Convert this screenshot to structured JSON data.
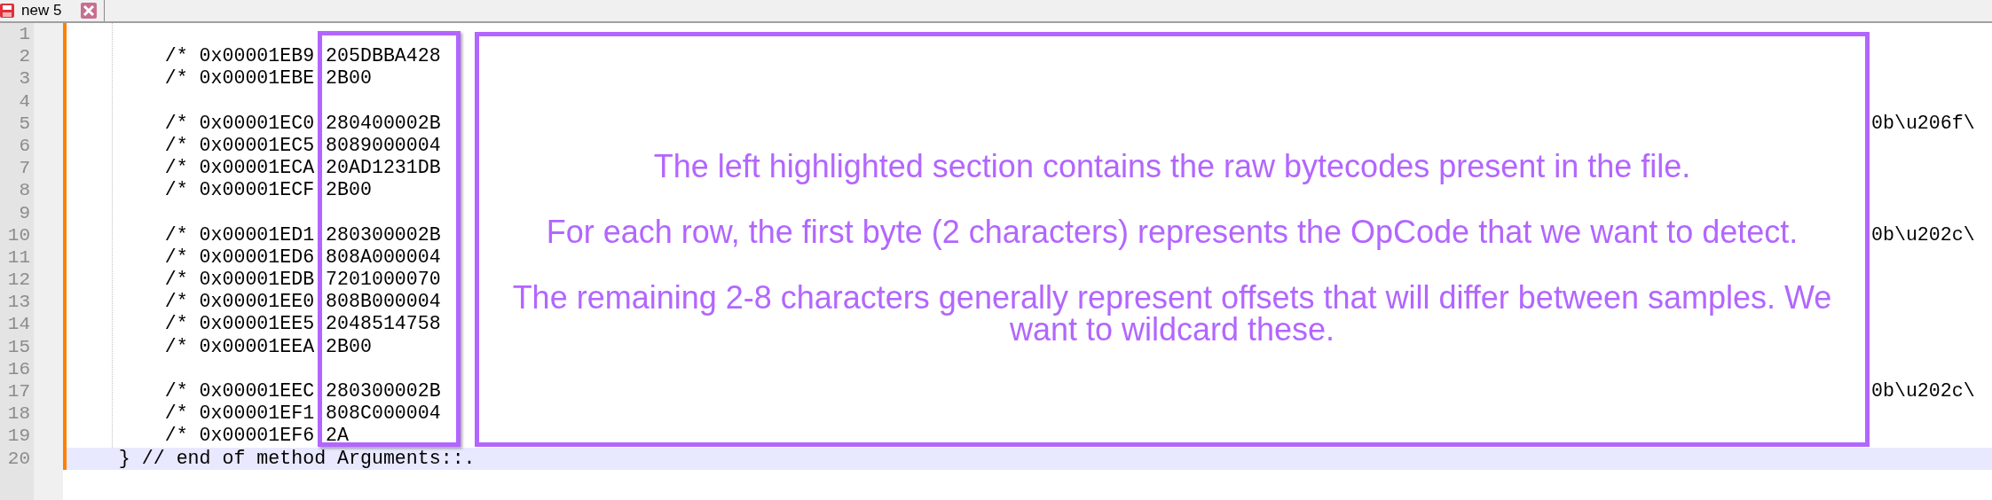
{
  "tab": {
    "title": "new 5",
    "selected": true
  },
  "editor": {
    "lines": [
      {
        "number": "1",
        "selected": false
      },
      {
        "number": "2",
        "code": "        /* 0x00001EB9 205DBBA428",
        "selected": false
      },
      {
        "number": "3",
        "code": "        /* 0x00001EBE 2B00",
        "selected": false
      },
      {
        "number": "4",
        "selected": false
      },
      {
        "number": "5",
        "code": "        /* 0x00001EC0 280400002B",
        "tail": "0b\\u206f\\",
        "selected": false
      },
      {
        "number": "6",
        "code": "        /* 0x00001EC5 8089000004",
        "selected": false
      },
      {
        "number": "7",
        "code": "        /* 0x00001ECA 20AD1231DB",
        "selected": false
      },
      {
        "number": "8",
        "code": "        /* 0x00001ECF 2B00",
        "selected": false
      },
      {
        "number": "9",
        "selected": false
      },
      {
        "number": "10",
        "code": "        /* 0x00001ED1 280300002B",
        "tail": "0b\\u202c\\",
        "selected": false
      },
      {
        "number": "11",
        "code": "        /* 0x00001ED6 808A000004",
        "selected": false
      },
      {
        "number": "12",
        "code": "        /* 0x00001EDB 7201000070",
        "selected": false
      },
      {
        "number": "13",
        "code": "        /* 0x00001EE0 808B000004",
        "selected": false
      },
      {
        "number": "14",
        "code": "        /* 0x00001EE5 2048514758",
        "selected": false
      },
      {
        "number": "15",
        "code": "        /* 0x00001EEA 2B00",
        "selected": false
      },
      {
        "number": "16",
        "selected": false
      },
      {
        "number": "17",
        "code": "        /* 0x00001EEC 280300002B",
        "tail": "0b\\u202c\\",
        "selected": false
      },
      {
        "number": "18",
        "code": "        /* 0x00001EF1 808C000004",
        "selected": false
      },
      {
        "number": "19",
        "code": "        /* 0x00001EF6 2A",
        "selected": false
      },
      {
        "number": "20",
        "code": "    } // end of method Arguments::.",
        "selected": true
      }
    ]
  },
  "annotation": {
    "paragraphs": [
      "The left highlighted section contains the raw bytecodes present in the file.",
      "For each row, the first byte (2 characters) represents the OpCode that we want to detect.",
      "The remaining 2-8 characters generally represent offsets that will differ between samples. We want to wildcard these."
    ]
  }
}
